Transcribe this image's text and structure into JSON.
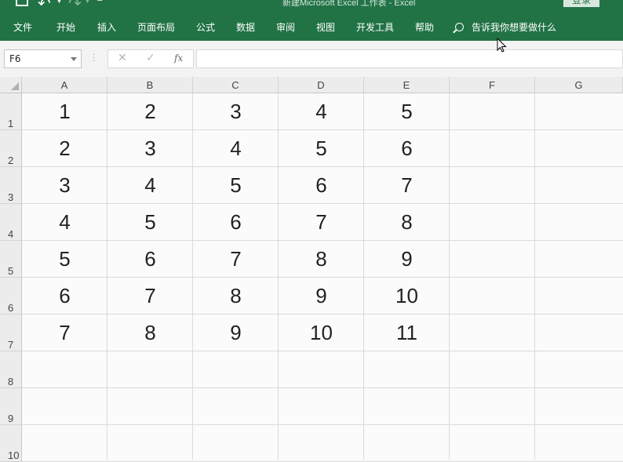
{
  "title_bar": {
    "title": "新建Microsoft Excel 工作表 - Excel",
    "login_label": "登录"
  },
  "ribbon": {
    "tabs": [
      "文件",
      "开始",
      "插入",
      "页面布局",
      "公式",
      "数据",
      "审阅",
      "视图",
      "开发工具",
      "帮助"
    ],
    "tell_me": "告诉我你想要做什么"
  },
  "formula_bar": {
    "name_box": "F6",
    "fx_label": "fx",
    "formula": ""
  },
  "sheet": {
    "columns": [
      "A",
      "B",
      "C",
      "D",
      "E",
      "F",
      "G"
    ],
    "rows": [
      "1",
      "2",
      "3",
      "4",
      "5",
      "6",
      "7",
      "8",
      "9",
      "10"
    ],
    "cells": [
      [
        "1",
        "2",
        "3",
        "4",
        "5"
      ],
      [
        "2",
        "3",
        "4",
        "5",
        "6"
      ],
      [
        "3",
        "4",
        "5",
        "6",
        "7"
      ],
      [
        "4",
        "5",
        "6",
        "7",
        "8"
      ],
      [
        "5",
        "6",
        "7",
        "8",
        "9"
      ],
      [
        "6",
        "7",
        "8",
        "9",
        "10"
      ],
      [
        "7",
        "8",
        "9",
        "10",
        "11"
      ]
    ]
  },
  "colors": {
    "accent": "#217346",
    "gridline": "#dadada",
    "header_bg": "#ececec"
  }
}
